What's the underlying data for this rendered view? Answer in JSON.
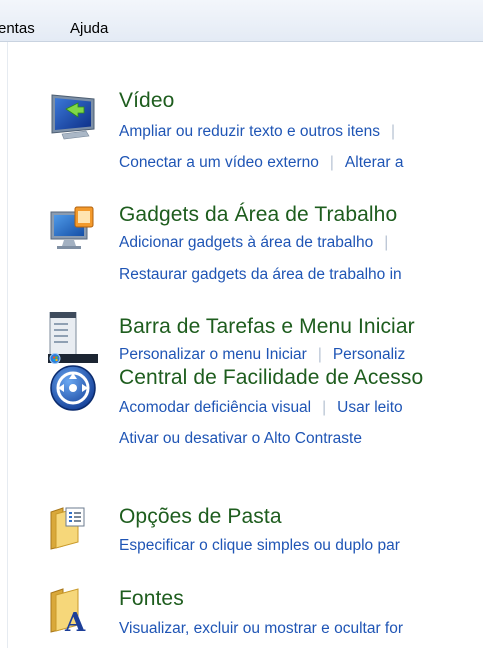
{
  "menu": {
    "items": [
      "entas",
      "Ajuda"
    ]
  },
  "categories": [
    {
      "title": "Vídeo",
      "icon": "monitor-icon",
      "lines": [
        [
          "Ampliar ou reduzir texto e outros itens",
          ""
        ],
        [
          "Conectar a um vídeo externo",
          "Alterar a"
        ]
      ]
    },
    {
      "title": "Gadgets da Área de Trabalho",
      "icon": "desktop-gadgets-icon",
      "lines": [
        [
          "Adicionar gadgets à área de trabalho",
          ""
        ],
        [
          "Restaurar gadgets da área de trabalho in"
        ]
      ]
    },
    {
      "title": "Barra de Tarefas e Menu Iniciar",
      "icon": "taskbar-start-menu-icon",
      "lines": [
        [
          "Personalizar o menu Iniciar",
          "Personaliz"
        ]
      ]
    },
    {
      "title": "Central de Facilidade de Acesso",
      "icon": "ease-of-access-icon",
      "lines": [
        [
          "Acomodar deficiência visual",
          "Usar leito"
        ],
        [
          "Ativar ou desativar o Alto Contraste"
        ]
      ]
    },
    {
      "title": "Opções de Pasta",
      "icon": "folder-options-icon",
      "lines": [
        [
          "Especificar o clique simples ou duplo par"
        ]
      ]
    },
    {
      "title": "Fontes",
      "icon": "fonts-folder-icon",
      "lines": [
        [
          "Visualizar, excluir ou mostrar e ocultar for"
        ]
      ]
    }
  ]
}
